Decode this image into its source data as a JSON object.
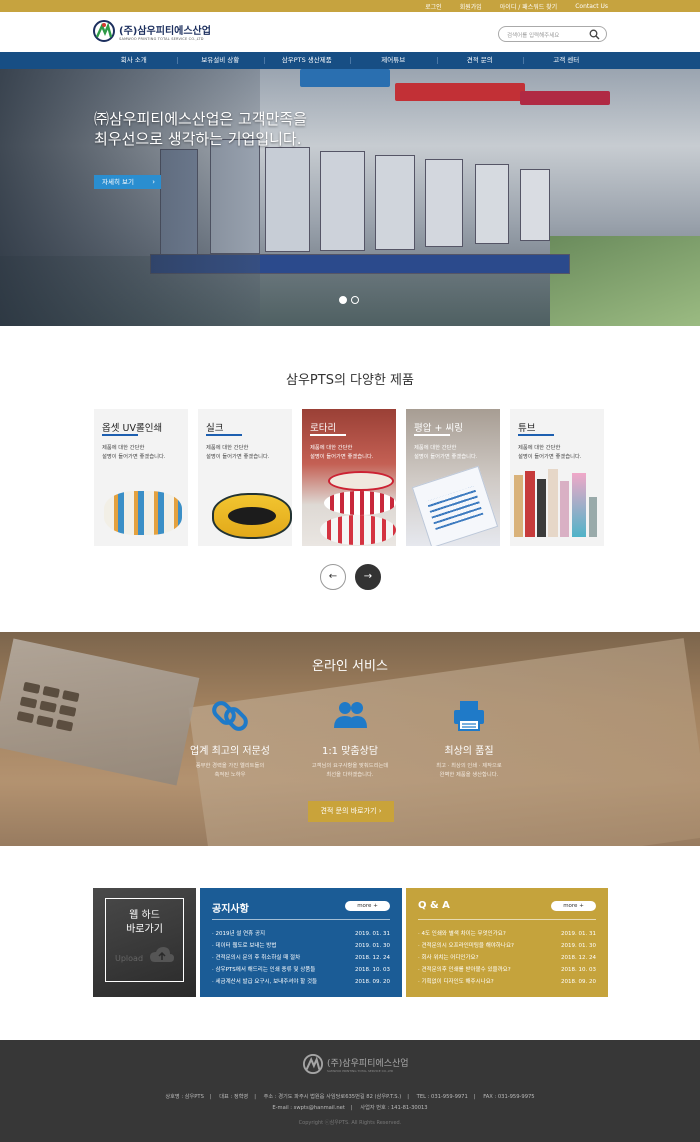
{
  "topbar": {
    "links": [
      "로그인",
      "회원가입",
      "아이디 / 패스워드 찾기",
      "Contact Us"
    ]
  },
  "header": {
    "logo_ko": "(주)삼우피티에스산업",
    "logo_en": "SAMWOO PRINTING TOTAL SERVICE CO.,LTD",
    "search_placeholder": "검색어를 입력해주세요"
  },
  "nav": {
    "items": [
      "회사 소개",
      "보유설비 상황",
      "삼우PTS 생산제품",
      "제어튜브",
      "견적 문의",
      "고객 센터"
    ]
  },
  "hero": {
    "title_line1": "㈜삼우피티에스산업은 고객만족을",
    "title_line2": "최우선으로 생각하는 기업입니다.",
    "button": "자세히 보기",
    "slides": 2,
    "active_slide": 1
  },
  "products": {
    "title": "삼우PTS의 다양한 제품",
    "desc_line1": "제품에 대한 간단한",
    "desc_line2": "설명이 들어가면 좋겠습니다.",
    "items": [
      {
        "name": "옵셋 UV롤인쇄"
      },
      {
        "name": "실크"
      },
      {
        "name": "로타리"
      },
      {
        "name": "평압 + 씨링"
      },
      {
        "name": "튜브"
      }
    ]
  },
  "service": {
    "title": "온라인 서비스",
    "features": [
      {
        "title": "업계 최고의 저문성",
        "desc1": "풍부한 경력을 가진 엘리트들의",
        "desc2": "축적된 노하우",
        "icon": "link-icon"
      },
      {
        "title": "1:1 맞춤상담",
        "desc1": "고객님의 요구사항을 맞춰드리는데",
        "desc2": "최선을 다하겠습니다.",
        "icon": "people-icon"
      },
      {
        "title": "최상의 품질",
        "desc1": "최고 · 최상의 인쇄 · 제작으로",
        "desc2": "완벽한 제품을 생산합니다.",
        "icon": "printer-icon"
      }
    ],
    "button": "견적 문의 바로가기"
  },
  "webhard": {
    "line1": "웹 하드",
    "line2": "바로가기",
    "upload": "Upload"
  },
  "notice": {
    "title": "공지사항",
    "more": "more",
    "items": [
      {
        "title": "2019년 설 연휴 공지",
        "date": "2019. 01. 31"
      },
      {
        "title": "데이터 웹도로 보내는 방법",
        "date": "2019. 01. 30"
      },
      {
        "title": "견적문의시 문의 후 취소하실 때 절차",
        "date": "2018. 12. 24"
      },
      {
        "title": "삼우PTS에서 해드리는 인쇄 종류 및 상품들",
        "date": "2018. 10. 03"
      },
      {
        "title": "세금계산서 발급 요구시, 보내주셔야 할 것들",
        "date": "2018. 09. 20"
      }
    ]
  },
  "qna": {
    "title": "Q & A",
    "more": "more",
    "items": [
      {
        "title": "4도 인쇄와 별색 차이는 무엇인가요?",
        "date": "2019. 01. 31"
      },
      {
        "title": "견적문의시 오프라인미팅을 해야하나요?",
        "date": "2019. 01. 30"
      },
      {
        "title": "회사 위치는 어디인가요?",
        "date": "2018. 12. 24"
      },
      {
        "title": "견적문의후 인쇄를 받아볼수 있을까요?",
        "date": "2018. 10. 03"
      },
      {
        "title": "기획없이 디자인도 해주시나요?",
        "date": "2018. 09. 20"
      }
    ]
  },
  "footer": {
    "logo_ko": "(주)삼우피티에스산업",
    "logo_en": "SAMWOO PRINTING TOTAL SERVICE CO.,LTD",
    "company": "상호명 : 삼우PTS",
    "ceo": "대표 : 정혁영",
    "address": "주소 : 경기도 파주시 법원읍 사임당로635번길 82 (삼우P.T.S.)",
    "tel": "TEL : 031-959-9971",
    "fax": "FAX : 031-959-9975",
    "email": "E-mail : swpts@hanmail.net",
    "bizno": "사업자 번호 : 141-81-30013",
    "copyright": "Copyright ⓒ삼우PTS. All Rights Reserved."
  },
  "colors": {
    "gold": "#c6a33f",
    "navy": "#174e84",
    "notice_blue": "#1b5c96",
    "qna_gold": "#c5a33c",
    "footer": "#373737",
    "hero_button": "#2a8ed0"
  }
}
